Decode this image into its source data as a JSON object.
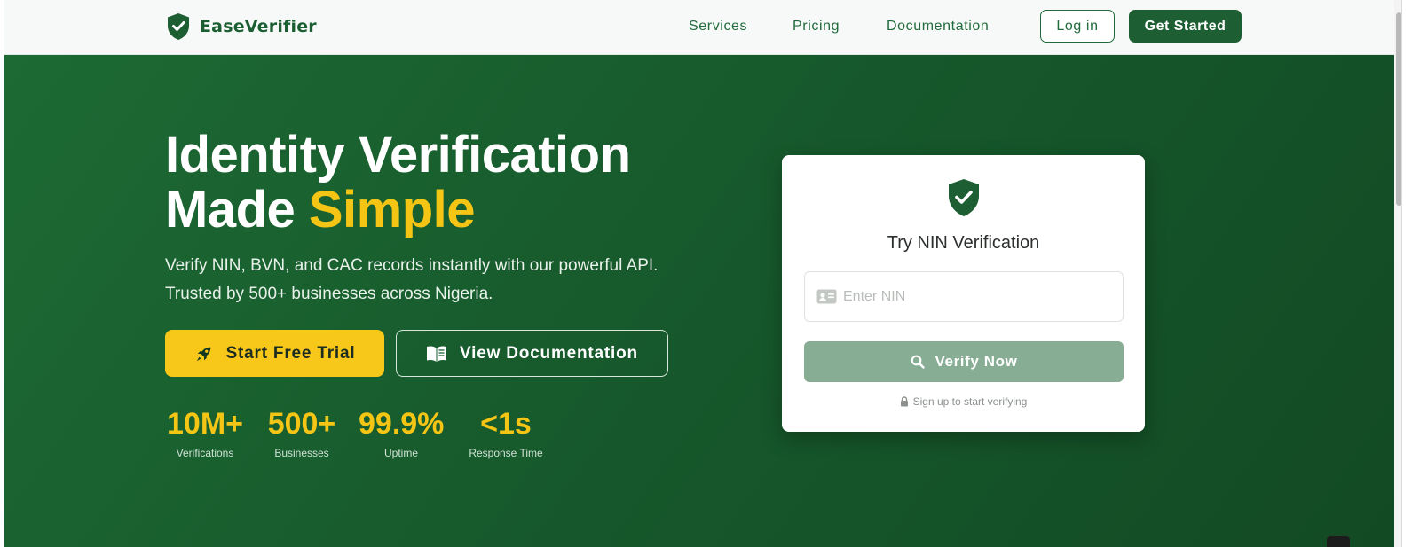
{
  "nav": {
    "brand": "EaseVerifier",
    "links": [
      "Services",
      "Pricing",
      "Documentation"
    ],
    "login_label": "Log in",
    "get_started_label": "Get Started"
  },
  "hero": {
    "title_line1": "Identity Verification",
    "title_line2_plain": "Made ",
    "title_line2_accent": "Simple",
    "subtitle": "Verify NIN, BVN, and CAC records instantly with our powerful API. Trusted by 500+ businesses across Nigeria.",
    "trial_label": "Start Free Trial",
    "docs_label": "View Documentation",
    "stats": [
      {
        "value": "10M+",
        "label": "Verifications"
      },
      {
        "value": "500+",
        "label": "Businesses"
      },
      {
        "value": "99.9%",
        "label": "Uptime"
      },
      {
        "value": "<1s",
        "label": "Response Time"
      }
    ]
  },
  "card": {
    "title": "Try NIN Verification",
    "input_placeholder": "Enter NIN",
    "input_value": "",
    "verify_label": "Verify Now",
    "note": "Sign up to start verifying"
  },
  "colors": {
    "brand_green": "#1e5e33",
    "hero_green": "#175a2c",
    "accent_yellow": "#f5c516",
    "verify_disabled": "#87ad95"
  },
  "icons": {
    "brand": "shield-check-icon",
    "trial": "rocket-icon",
    "docs": "book-icon",
    "card": "shield-check-icon",
    "input": "id-card-icon",
    "verify": "search-icon",
    "note": "lock-icon"
  }
}
